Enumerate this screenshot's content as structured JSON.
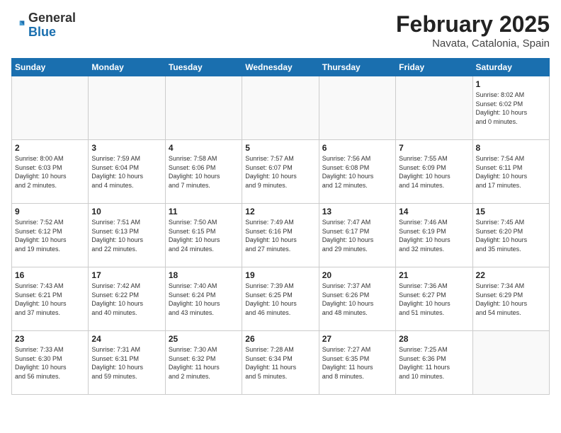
{
  "header": {
    "logo_general": "General",
    "logo_blue": "Blue",
    "title": "February 2025",
    "subtitle": "Navata, Catalonia, Spain"
  },
  "weekdays": [
    "Sunday",
    "Monday",
    "Tuesday",
    "Wednesday",
    "Thursday",
    "Friday",
    "Saturday"
  ],
  "weeks": [
    [
      {
        "day": "",
        "info": ""
      },
      {
        "day": "",
        "info": ""
      },
      {
        "day": "",
        "info": ""
      },
      {
        "day": "",
        "info": ""
      },
      {
        "day": "",
        "info": ""
      },
      {
        "day": "",
        "info": ""
      },
      {
        "day": "1",
        "info": "Sunrise: 8:02 AM\nSunset: 6:02 PM\nDaylight: 10 hours\nand 0 minutes."
      }
    ],
    [
      {
        "day": "2",
        "info": "Sunrise: 8:00 AM\nSunset: 6:03 PM\nDaylight: 10 hours\nand 2 minutes."
      },
      {
        "day": "3",
        "info": "Sunrise: 7:59 AM\nSunset: 6:04 PM\nDaylight: 10 hours\nand 4 minutes."
      },
      {
        "day": "4",
        "info": "Sunrise: 7:58 AM\nSunset: 6:06 PM\nDaylight: 10 hours\nand 7 minutes."
      },
      {
        "day": "5",
        "info": "Sunrise: 7:57 AM\nSunset: 6:07 PM\nDaylight: 10 hours\nand 9 minutes."
      },
      {
        "day": "6",
        "info": "Sunrise: 7:56 AM\nSunset: 6:08 PM\nDaylight: 10 hours\nand 12 minutes."
      },
      {
        "day": "7",
        "info": "Sunrise: 7:55 AM\nSunset: 6:09 PM\nDaylight: 10 hours\nand 14 minutes."
      },
      {
        "day": "8",
        "info": "Sunrise: 7:54 AM\nSunset: 6:11 PM\nDaylight: 10 hours\nand 17 minutes."
      }
    ],
    [
      {
        "day": "9",
        "info": "Sunrise: 7:52 AM\nSunset: 6:12 PM\nDaylight: 10 hours\nand 19 minutes."
      },
      {
        "day": "10",
        "info": "Sunrise: 7:51 AM\nSunset: 6:13 PM\nDaylight: 10 hours\nand 22 minutes."
      },
      {
        "day": "11",
        "info": "Sunrise: 7:50 AM\nSunset: 6:15 PM\nDaylight: 10 hours\nand 24 minutes."
      },
      {
        "day": "12",
        "info": "Sunrise: 7:49 AM\nSunset: 6:16 PM\nDaylight: 10 hours\nand 27 minutes."
      },
      {
        "day": "13",
        "info": "Sunrise: 7:47 AM\nSunset: 6:17 PM\nDaylight: 10 hours\nand 29 minutes."
      },
      {
        "day": "14",
        "info": "Sunrise: 7:46 AM\nSunset: 6:19 PM\nDaylight: 10 hours\nand 32 minutes."
      },
      {
        "day": "15",
        "info": "Sunrise: 7:45 AM\nSunset: 6:20 PM\nDaylight: 10 hours\nand 35 minutes."
      }
    ],
    [
      {
        "day": "16",
        "info": "Sunrise: 7:43 AM\nSunset: 6:21 PM\nDaylight: 10 hours\nand 37 minutes."
      },
      {
        "day": "17",
        "info": "Sunrise: 7:42 AM\nSunset: 6:22 PM\nDaylight: 10 hours\nand 40 minutes."
      },
      {
        "day": "18",
        "info": "Sunrise: 7:40 AM\nSunset: 6:24 PM\nDaylight: 10 hours\nand 43 minutes."
      },
      {
        "day": "19",
        "info": "Sunrise: 7:39 AM\nSunset: 6:25 PM\nDaylight: 10 hours\nand 46 minutes."
      },
      {
        "day": "20",
        "info": "Sunrise: 7:37 AM\nSunset: 6:26 PM\nDaylight: 10 hours\nand 48 minutes."
      },
      {
        "day": "21",
        "info": "Sunrise: 7:36 AM\nSunset: 6:27 PM\nDaylight: 10 hours\nand 51 minutes."
      },
      {
        "day": "22",
        "info": "Sunrise: 7:34 AM\nSunset: 6:29 PM\nDaylight: 10 hours\nand 54 minutes."
      }
    ],
    [
      {
        "day": "23",
        "info": "Sunrise: 7:33 AM\nSunset: 6:30 PM\nDaylight: 10 hours\nand 56 minutes."
      },
      {
        "day": "24",
        "info": "Sunrise: 7:31 AM\nSunset: 6:31 PM\nDaylight: 10 hours\nand 59 minutes."
      },
      {
        "day": "25",
        "info": "Sunrise: 7:30 AM\nSunset: 6:32 PM\nDaylight: 11 hours\nand 2 minutes."
      },
      {
        "day": "26",
        "info": "Sunrise: 7:28 AM\nSunset: 6:34 PM\nDaylight: 11 hours\nand 5 minutes."
      },
      {
        "day": "27",
        "info": "Sunrise: 7:27 AM\nSunset: 6:35 PM\nDaylight: 11 hours\nand 8 minutes."
      },
      {
        "day": "28",
        "info": "Sunrise: 7:25 AM\nSunset: 6:36 PM\nDaylight: 11 hours\nand 10 minutes."
      },
      {
        "day": "",
        "info": ""
      }
    ]
  ]
}
